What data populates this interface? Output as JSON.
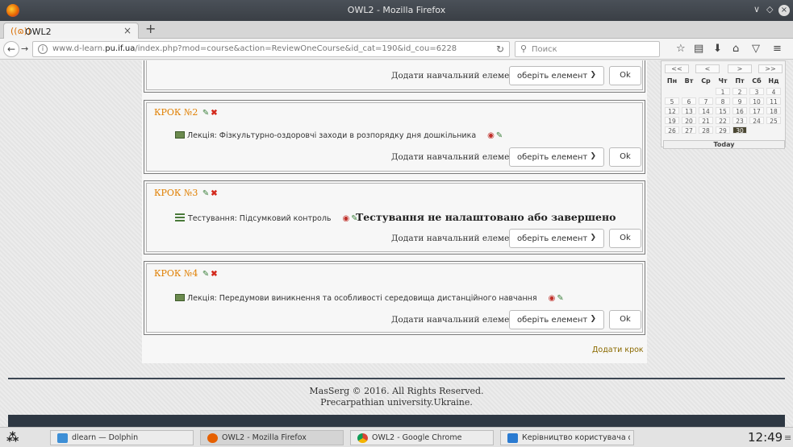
{
  "window": {
    "title": "OWL2 - Mozilla Firefox",
    "controls": {
      "minimize": "∨",
      "maximize": "◇",
      "close": "×"
    }
  },
  "tab": {
    "label": "OWL2",
    "close": "×",
    "new_tab": "+"
  },
  "navbar": {
    "url_prefix": "www.d-learn.",
    "url_domain": "pu.if.ua",
    "url_path": "/index.php?mod=course&action=ReviewOneCourse&id_cat=190&id_cou=6228",
    "search_placeholder": "Поиск"
  },
  "calendar": {
    "nav": [
      "<<",
      "<",
      ">",
      ">>"
    ],
    "weekdays": [
      "Пн",
      "Вт",
      "Ср",
      "Чт",
      "Пт",
      "Сб",
      "Нд"
    ],
    "rows": [
      [
        "",
        "",
        "",
        "1",
        "2",
        "3",
        "4"
      ],
      [
        "5",
        "6",
        "7",
        "8",
        "9",
        "10",
        "11"
      ],
      [
        "12",
        "13",
        "14",
        "15",
        "16",
        "17",
        "18"
      ],
      [
        "19",
        "20",
        "21",
        "22",
        "23",
        "24",
        "25"
      ],
      [
        "26",
        "27",
        "28",
        "29",
        "30",
        "",
        ""
      ]
    ],
    "today_day": "30",
    "today_label": "Today"
  },
  "add_element": {
    "label": "Додати навчальний елемент:",
    "select_value": "оберіть елемент",
    "ok": "Ok"
  },
  "steps": [
    {
      "title": "КРОК №2",
      "item_type": "lecture",
      "item_text": "Лекція: Фізкультурно-оздоровчі заходи в розпорядку дня дошкільника"
    },
    {
      "title": "КРОК №3",
      "item_type": "test",
      "item_text": "Тестування: Підсумковий контроль",
      "warning": "Тестування не налаштовано або завершено"
    },
    {
      "title": "КРОК №4",
      "item_type": "lecture",
      "item_text": "Лекція: Передумови виникнення та особливості середовища дистанційного навчання"
    }
  ],
  "add_step": "Додати крок",
  "footer": {
    "line1": "MasSerg © 2016. All Rights Reserved.",
    "line2": "Precarpathian university.Ukraine."
  },
  "taskbar": {
    "items": [
      {
        "label": "dlearn — Dolphin"
      },
      {
        "label": "OWL2 - Mozilla Firefox"
      },
      {
        "label": "OWL2 - Google Chrome"
      },
      {
        "label": "Керівництво користувача d-learn"
      }
    ],
    "clock": "12:49"
  },
  "colors": {
    "accent_orange": "#e07f00",
    "link_olive": "#8b6a00",
    "footer_dark": "#2e3843"
  }
}
